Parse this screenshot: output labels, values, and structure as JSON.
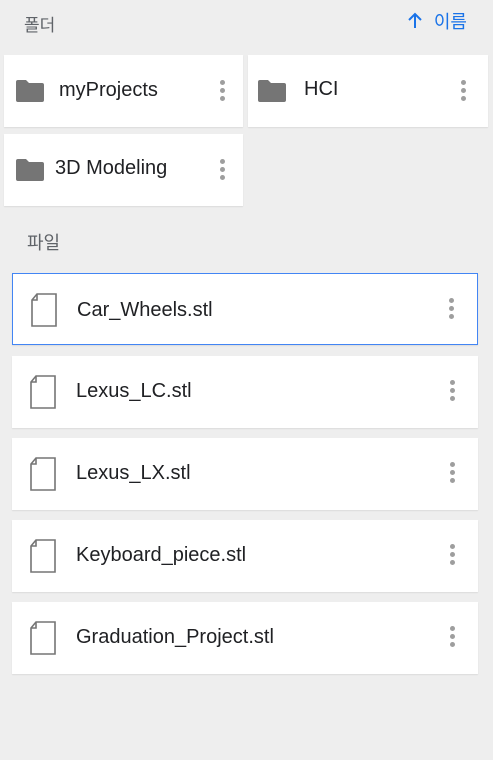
{
  "header": {
    "folders_label": "폴더",
    "sort_label": "이름",
    "sort_icon": "arrow-up-icon"
  },
  "folders": [
    {
      "name": "myProjects",
      "icon": "folder-icon"
    },
    {
      "name": "HCI",
      "icon": "folder-icon"
    },
    {
      "name": "3D Modeling",
      "icon": "folder-icon"
    }
  ],
  "files_label": "파일",
  "files": [
    {
      "name": "Car_Wheels.stl",
      "icon": "file-icon",
      "selected": true
    },
    {
      "name": "Lexus_LC.stl",
      "icon": "file-icon",
      "selected": false
    },
    {
      "name": "Lexus_LX.stl",
      "icon": "file-icon",
      "selected": false
    },
    {
      "name": "Keyboard_piece.stl",
      "icon": "file-icon",
      "selected": false
    },
    {
      "name": "Graduation_Project.stl",
      "icon": "file-icon",
      "selected": false
    }
  ],
  "colors": {
    "background": "#eeeeee",
    "accent": "#1a73e8",
    "selection_border": "#4285f4",
    "icon_gray": "#757575"
  }
}
